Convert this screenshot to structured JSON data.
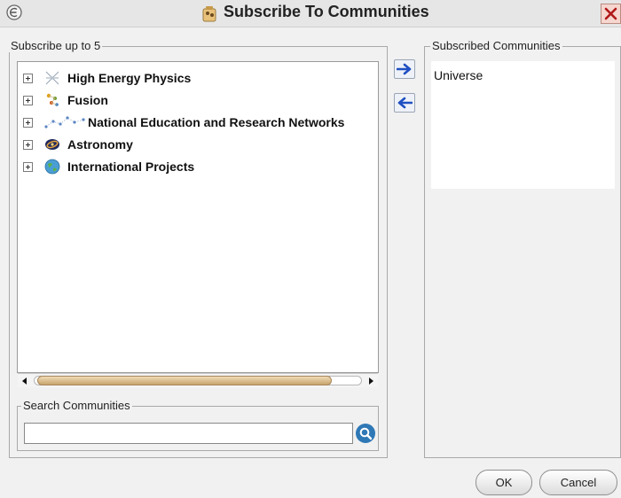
{
  "window": {
    "title": "Subscribe To Communities",
    "close_icon": "close-icon",
    "logo_icon": "app-logo-icon"
  },
  "available": {
    "legend": "Subscribe up to 5",
    "nodes": [
      {
        "label": "High Energy Physics",
        "icon": "particle-collision-icon"
      },
      {
        "label": "Fusion",
        "icon": "fusion-icon"
      },
      {
        "label": "National Education and Research Networks",
        "icon": "network-icon"
      },
      {
        "label": "Astronomy",
        "icon": "galaxy-icon"
      },
      {
        "label": "International Projects",
        "icon": "globe-icon"
      }
    ]
  },
  "search": {
    "legend": "Search Communities",
    "value": "",
    "placeholder": "",
    "button_icon": "search-icon"
  },
  "transfer": {
    "add_icon": "arrow-right-icon",
    "remove_icon": "arrow-left-icon"
  },
  "subscribed": {
    "legend": "Subscribed Communities",
    "items": [
      "Universe"
    ]
  },
  "footer": {
    "ok_label": "OK",
    "cancel_label": "Cancel"
  },
  "colors": {
    "accent_blue": "#2f78b6",
    "scroll_thumb": "#c8a46c",
    "close_button": "#f6d6cf"
  }
}
